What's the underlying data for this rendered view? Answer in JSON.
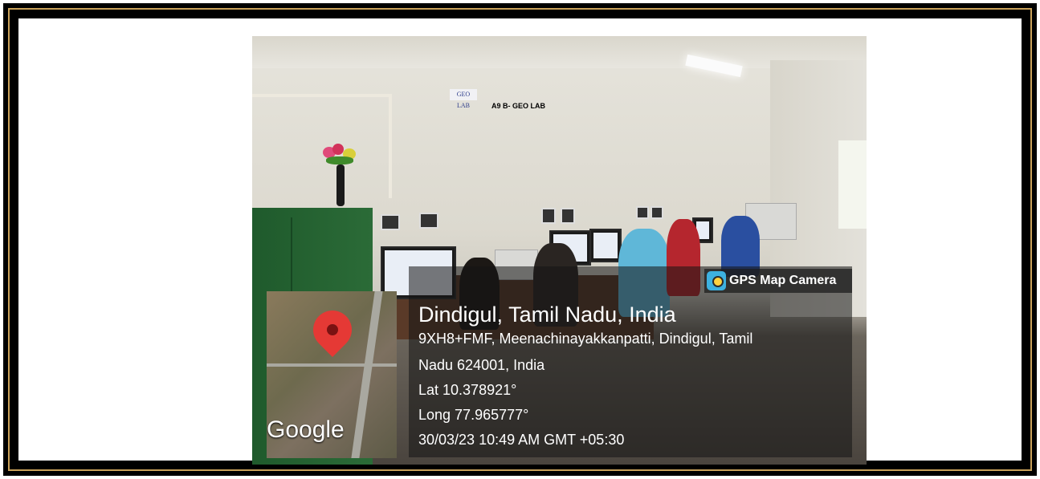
{
  "photo": {
    "sign_small": "GEO LAB",
    "room_label": "A9 B- GEO LAB"
  },
  "stamp": {
    "badge": "GPS Map Camera",
    "location_title": "Dindigul, Tamil Nadu, India",
    "address_line1": "9XH8+FMF, Meenachinayakkanpatti, Dindigul, Tamil",
    "address_line2": "Nadu 624001, India",
    "latitude": "Lat 10.378921°",
    "longitude": "Long 77.965777°",
    "datetime": "30/03/23 10:49 AM GMT +05:30",
    "map_logo": "Google",
    "pin_icon": "map-pin-icon",
    "camera_icon": "gps-map-camera-icon"
  },
  "colors": {
    "frame": "#000000",
    "frame_accent": "#c9a15a",
    "pin": "#e53935",
    "overlay": "rgba(20,20,20,0.55)"
  }
}
